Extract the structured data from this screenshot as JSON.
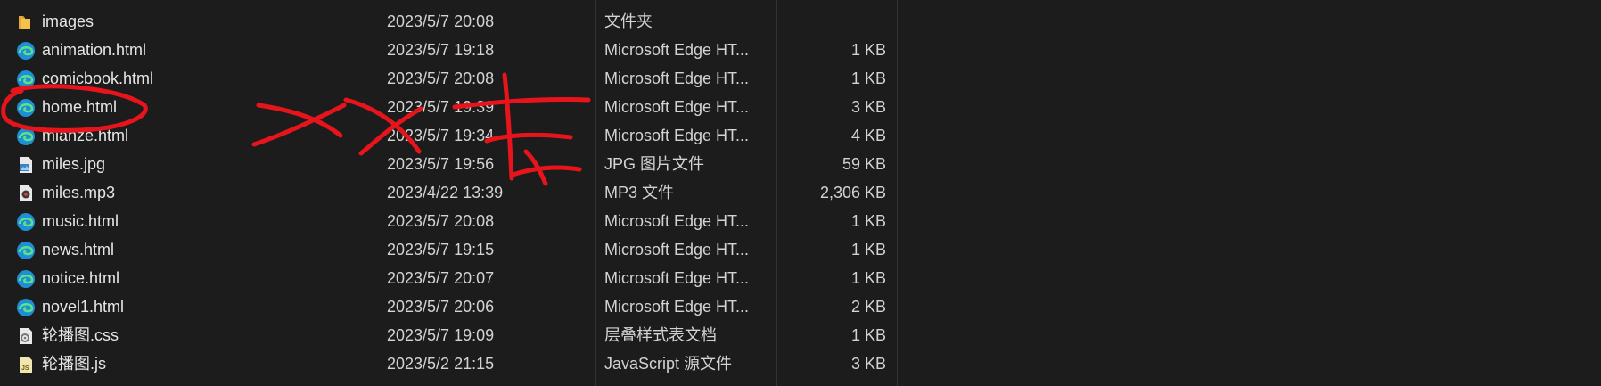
{
  "files": [
    {
      "name": "images",
      "date": "2023/5/7 20:08",
      "type": "文件夹",
      "size": "",
      "icon": "folder-icon"
    },
    {
      "name": "animation.html",
      "date": "2023/5/7 19:18",
      "type": "Microsoft Edge HT...",
      "size": "1 KB",
      "icon": "edge-icon"
    },
    {
      "name": "comicbook.html",
      "date": "2023/5/7 20:08",
      "type": "Microsoft Edge HT...",
      "size": "1 KB",
      "icon": "edge-icon"
    },
    {
      "name": "home.html",
      "date": "2023/5/7 19:39",
      "type": "Microsoft Edge HT...",
      "size": "3 KB",
      "icon": "edge-icon"
    },
    {
      "name": "mianze.html",
      "date": "2023/5/7 19:34",
      "type": "Microsoft Edge HT...",
      "size": "4 KB",
      "icon": "edge-icon"
    },
    {
      "name": "miles.jpg",
      "date": "2023/5/7 19:56",
      "type": "JPG 图片文件",
      "size": "59 KB",
      "icon": "jpg-icon"
    },
    {
      "name": "miles.mp3",
      "date": "2023/4/22 13:39",
      "type": "MP3 文件",
      "size": "2,306 KB",
      "icon": "mp3-icon"
    },
    {
      "name": "music.html",
      "date": "2023/5/7 20:08",
      "type": "Microsoft Edge HT...",
      "size": "1 KB",
      "icon": "edge-icon"
    },
    {
      "name": "news.html",
      "date": "2023/5/7 19:15",
      "type": "Microsoft Edge HT...",
      "size": "1 KB",
      "icon": "edge-icon"
    },
    {
      "name": "notice.html",
      "date": "2023/5/7 20:07",
      "type": "Microsoft Edge HT...",
      "size": "1 KB",
      "icon": "edge-icon"
    },
    {
      "name": "novel1.html",
      "date": "2023/5/7 20:06",
      "type": "Microsoft Edge HT...",
      "size": "2 KB",
      "icon": "edge-icon"
    },
    {
      "name": "轮播图.css",
      "date": "2023/5/7 19:09",
      "type": "层叠样式表文档",
      "size": "1 KB",
      "icon": "css-icon"
    },
    {
      "name": "轮播图.js",
      "date": "2023/5/2 21:15",
      "type": "JavaScript 源文件",
      "size": "3 KB",
      "icon": "js-icon"
    }
  ],
  "colors": {
    "background": "#1c1c1c",
    "text": "#e6e6e6",
    "annotation": "#e8141c",
    "folder": "#f4c24a",
    "edge": "#1fa8d9"
  }
}
